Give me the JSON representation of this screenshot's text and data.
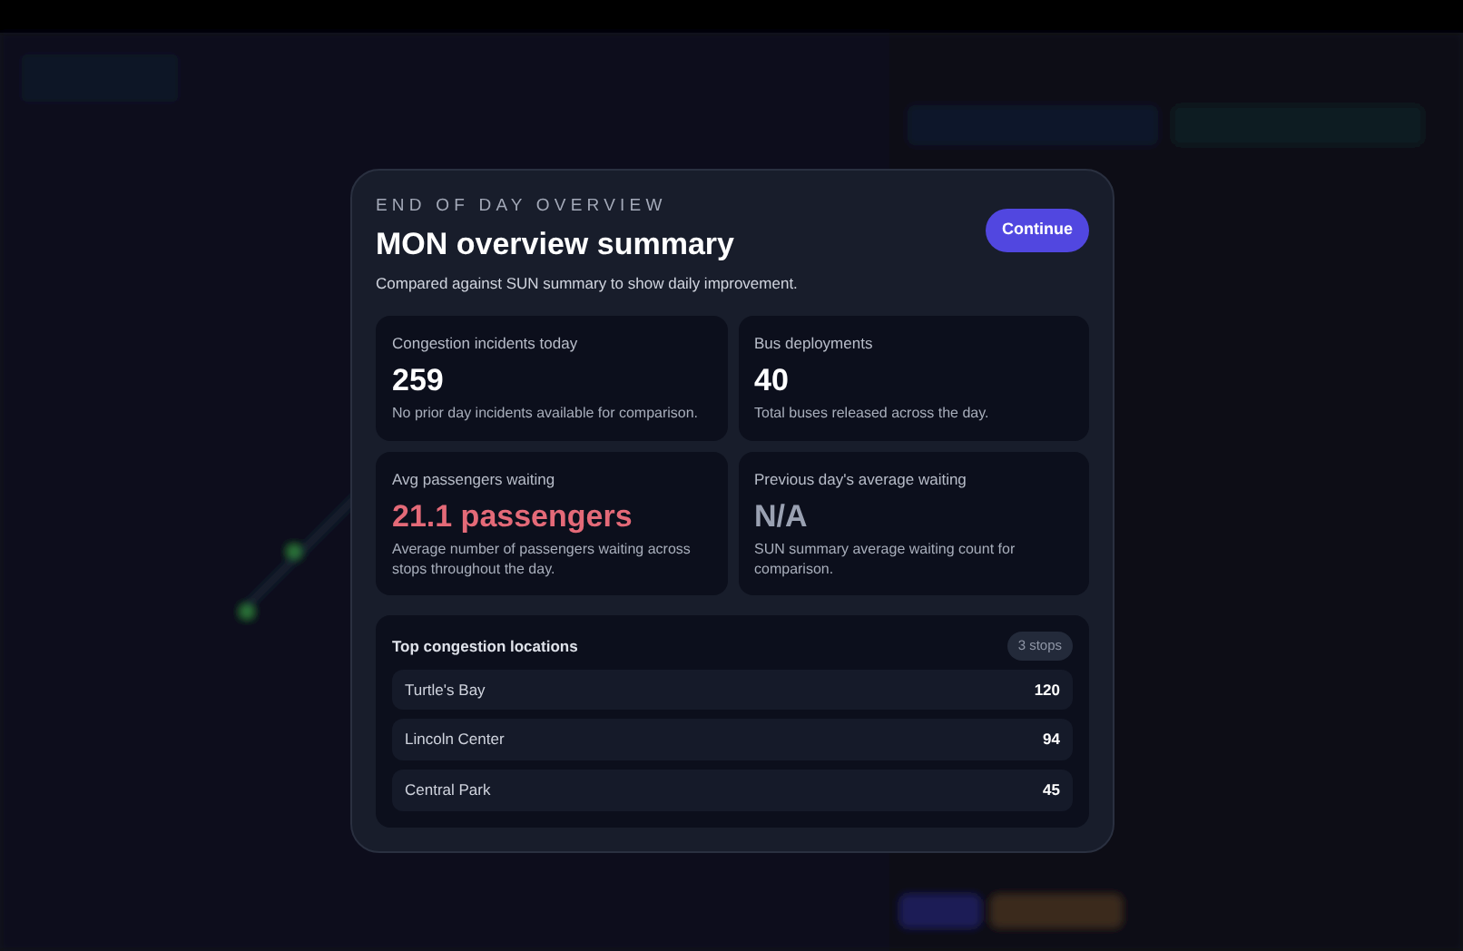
{
  "modal": {
    "eyebrow": "END OF DAY OVERVIEW",
    "title": "MON overview summary",
    "subtitle": "Compared against SUN summary to show daily improvement.",
    "continue_button": "Continue",
    "stats": [
      {
        "label": "Congestion incidents today",
        "value": "259",
        "note": "No prior day incidents available for comparison.",
        "color": "#ffffff"
      },
      {
        "label": "Bus deployments",
        "value": "40",
        "note": "Total buses released across the day.",
        "color": "#ffffff"
      },
      {
        "label": "Avg passengers waiting",
        "value": "21.1 passengers",
        "note": "Average number of passengers waiting across stops throughout the day.",
        "color": "#e46a78"
      },
      {
        "label": "Previous day's average waiting",
        "value": "N/A",
        "note": "SUN summary average waiting count for comparison.",
        "color": "#9aa1b2"
      }
    ],
    "locations": {
      "title": "Top congestion locations",
      "count": "3 stops",
      "items": [
        {
          "name": "Turtle's Bay",
          "value": "120"
        },
        {
          "name": "Lincoln Center",
          "value": "94"
        },
        {
          "name": "Central Park",
          "value": "45"
        }
      ]
    }
  }
}
